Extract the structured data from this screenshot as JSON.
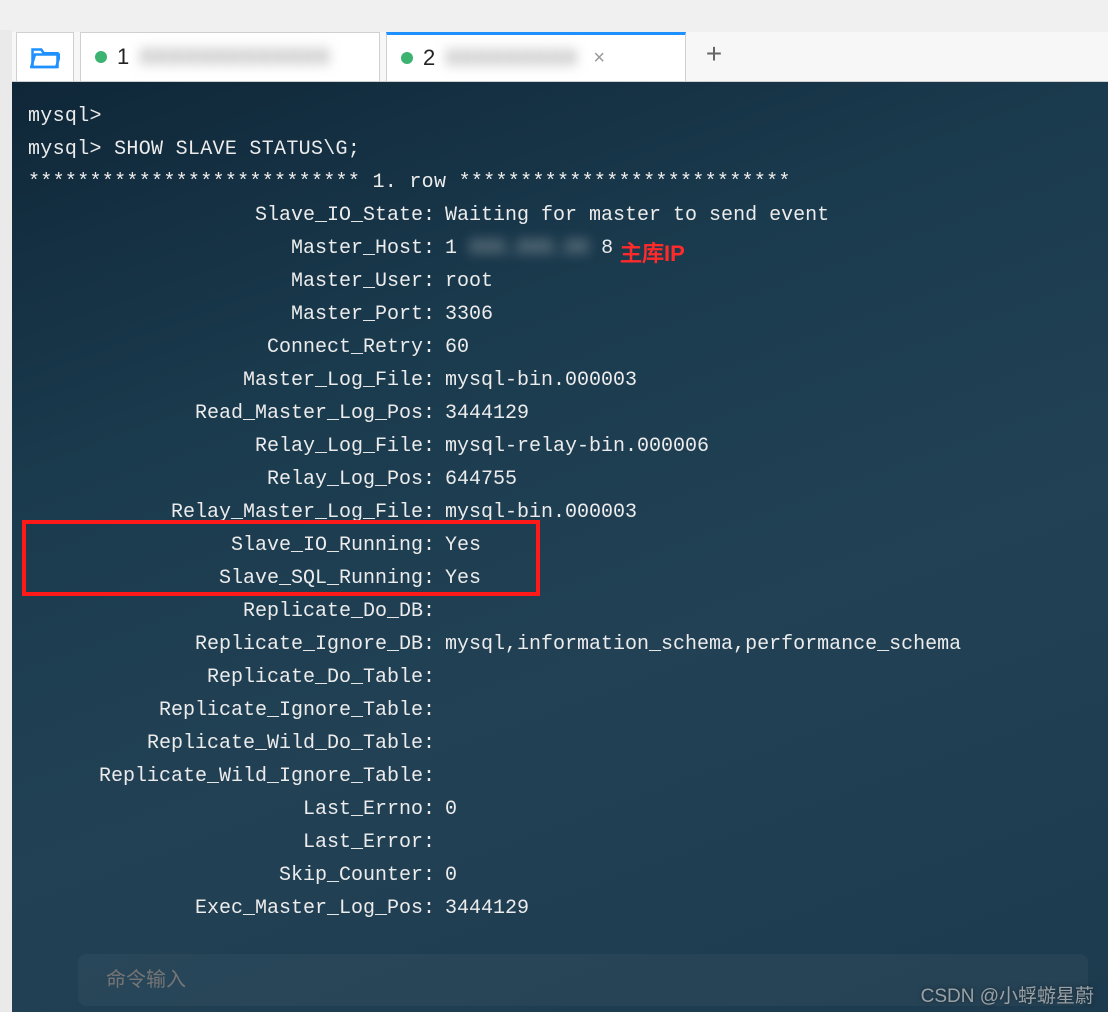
{
  "tabs": {
    "tab1": {
      "num": "1",
      "text_blur": "XXXXXXXXXXXXX"
    },
    "tab2": {
      "num": "2",
      "text_blur": "XXXXXXXXX",
      "close": "×"
    },
    "plus": "+"
  },
  "prompt1": "mysql>",
  "prompt2": "mysql> SHOW SLAVE STATUS\\G;",
  "row_header": "*************************** 1. row ***************************",
  "rows": [
    {
      "key": "Slave_IO_State",
      "val": "Waiting for master to send event"
    },
    {
      "key": "Master_Host",
      "val": "1                8",
      "blurmid": true
    },
    {
      "key": "Master_User",
      "val": "root"
    },
    {
      "key": "Master_Port",
      "val": "3306"
    },
    {
      "key": "Connect_Retry",
      "val": "60"
    },
    {
      "key": "Master_Log_File",
      "val": "mysql-bin.000003"
    },
    {
      "key": "Read_Master_Log_Pos",
      "val": "3444129"
    },
    {
      "key": "Relay_Log_File",
      "val": "mysql-relay-bin.000006"
    },
    {
      "key": "Relay_Log_Pos",
      "val": "644755"
    },
    {
      "key": "Relay_Master_Log_File",
      "val": "mysql-bin.000003"
    },
    {
      "key": "Slave_IO_Running",
      "val": "Yes"
    },
    {
      "key": "Slave_SQL_Running",
      "val": "Yes"
    },
    {
      "key": "Replicate_Do_DB",
      "val": ""
    },
    {
      "key": "Replicate_Ignore_DB",
      "val": "mysql,information_schema,performance_schema"
    },
    {
      "key": "Replicate_Do_Table",
      "val": ""
    },
    {
      "key": "Replicate_Ignore_Table",
      "val": ""
    },
    {
      "key": "Replicate_Wild_Do_Table",
      "val": ""
    },
    {
      "key": "Replicate_Wild_Ignore_Table",
      "val": ""
    },
    {
      "key": "Last_Errno",
      "val": "0"
    },
    {
      "key": "Last_Error",
      "val": ""
    },
    {
      "key": "Skip_Counter",
      "val": "0"
    },
    {
      "key": "Exec_Master_Log_Pos",
      "val": "3444129"
    }
  ],
  "annotation_master_ip": "主库IP",
  "input_placeholder": "命令输入",
  "watermark": "CSDN @小蜉蝣星蔚"
}
